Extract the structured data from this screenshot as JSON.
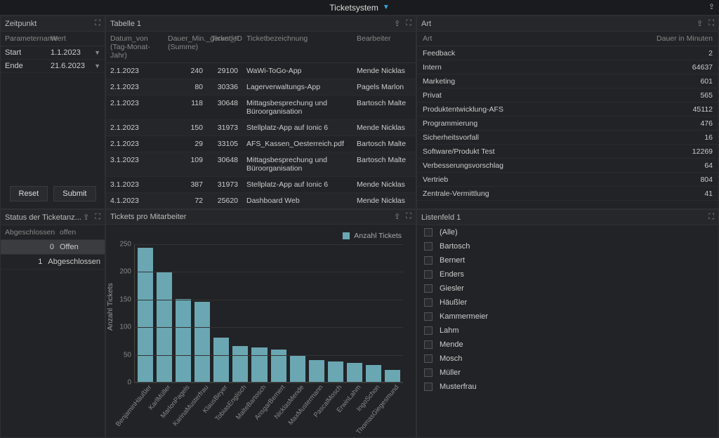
{
  "app": {
    "title": "Ticketsystem"
  },
  "zeitpunkt": {
    "title": "Zeitpunkt",
    "param_label": "Parametername",
    "value_label": "Wert",
    "rows": [
      {
        "name": "Start",
        "value": "1.1.2023"
      },
      {
        "name": "Ende",
        "value": "21.6.2023"
      }
    ],
    "reset_label": "Reset",
    "submit_label": "Submit"
  },
  "tabelle1": {
    "title": "Tabelle 1",
    "columns": {
      "datum": "Datum_von (Tag-Monat-Jahr)",
      "dauer": "Dauer_Min._gerundet (Summe)",
      "ticket_id": "Ticket_ID",
      "bezeichnung": "Ticketbezeichnung",
      "bearbeiter": "Bearbeiter"
    },
    "rows": [
      {
        "datum": "2.1.2023",
        "dauer": "240",
        "ticket_id": "29100",
        "bez": "WaWi-ToGo-App",
        "bearbeiter": "Mende Nicklas"
      },
      {
        "datum": "2.1.2023",
        "dauer": "80",
        "ticket_id": "30336",
        "bez": "Lagerverwaltungs-App",
        "bearbeiter": "Pagels Marlon"
      },
      {
        "datum": "2.1.2023",
        "dauer": "118",
        "ticket_id": "30648",
        "bez": "Mittagsbesprechung und Büroorganisation",
        "bearbeiter": "Bartosch Malte"
      },
      {
        "datum": "2.1.2023",
        "dauer": "150",
        "ticket_id": "31973",
        "bez": "Stellplatz-App auf Ionic 6",
        "bearbeiter": "Mende Nicklas"
      },
      {
        "datum": "2.1.2023",
        "dauer": "29",
        "ticket_id": "33105",
        "bez": "AFS_Kassen_Oesterreich.pdf",
        "bearbeiter": "Bartosch Malte"
      },
      {
        "datum": "3.1.2023",
        "dauer": "109",
        "ticket_id": "30648",
        "bez": "Mittagsbesprechung und Büroorganisation",
        "bearbeiter": "Bartosch Malte"
      },
      {
        "datum": "3.1.2023",
        "dauer": "387",
        "ticket_id": "31973",
        "bez": "Stellplatz-App auf Ionic 6",
        "bearbeiter": "Mende Nicklas"
      },
      {
        "datum": "4.1.2023",
        "dauer": "72",
        "ticket_id": "25620",
        "bez": "Dashboard Web",
        "bearbeiter": "Mende Nicklas"
      }
    ]
  },
  "art": {
    "title": "Art",
    "col_art": "Art",
    "col_dauer": "Dauer in Minuten",
    "rows": [
      {
        "name": "Feedback",
        "value": "2"
      },
      {
        "name": "Intern",
        "value": "64637"
      },
      {
        "name": "Marketing",
        "value": "601"
      },
      {
        "name": "Privat",
        "value": "565"
      },
      {
        "name": "Produktentwicklung-AFS",
        "value": "45112"
      },
      {
        "name": "Programmierung",
        "value": "476"
      },
      {
        "name": "Sicherheitsvorfall",
        "value": "16"
      },
      {
        "name": "Software/Produkt Test",
        "value": "12269"
      },
      {
        "name": "Verbesserungsvorschlag",
        "value": "64"
      },
      {
        "name": "Vertrieb",
        "value": "804"
      },
      {
        "name": "Zentrale-Vermittlung",
        "value": "41"
      }
    ]
  },
  "status": {
    "title": "Status der Ticketanz...",
    "col1": "Abgeschlossen",
    "col2": "offen",
    "rows": [
      {
        "count": "0",
        "label": "Offen",
        "selected": true
      },
      {
        "count": "1",
        "label": "Abgeschlossen",
        "selected": false
      }
    ]
  },
  "listenfeld": {
    "title": "Listenfeld 1",
    "items": [
      "(Alle)",
      "Bartosch",
      "Bernert",
      "Enders",
      "Giesler",
      "Häußler",
      "Kammermeier",
      "Lahm",
      "Mende",
      "Mosch",
      "Müller",
      "Musterfrau"
    ]
  },
  "chart": {
    "title": "Tickets pro Mitarbeiter",
    "legend": "Anzahl Tickets",
    "ylabel": "Anzahl Tickets"
  },
  "chart_data": {
    "type": "bar",
    "title": "Tickets pro Mitarbeiter",
    "xlabel": "",
    "ylabel": "Anzahl Tickets",
    "ylim": [
      0,
      250
    ],
    "yticks": [
      0,
      50,
      100,
      150,
      200,
      250
    ],
    "categories": [
      "BenjaminHäußler",
      "KarlMüller",
      "MarlonPagels",
      "KarinaMusterfrau",
      "KlausBeyer",
      "TobiasEnglisch",
      "MalteBartosch",
      "AnsgarBernert",
      "NicklasMende",
      "MaxMustermann",
      "PascalMosch",
      "ErwinLahm",
      "IngoSchon",
      "ThomasGiegesmund"
    ],
    "values": [
      243,
      200,
      150,
      145,
      80,
      65,
      62,
      58,
      48,
      40,
      37,
      35,
      30,
      22
    ],
    "series": [
      {
        "name": "Anzahl Tickets",
        "color": "#6aa7b3"
      }
    ]
  }
}
